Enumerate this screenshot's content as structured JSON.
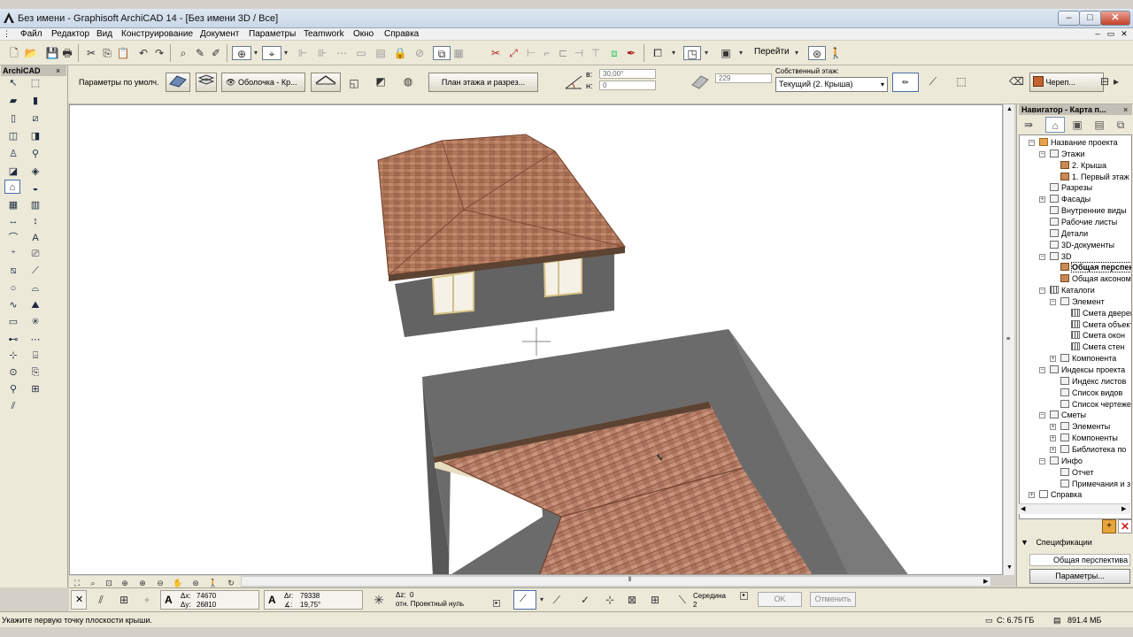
{
  "window": {
    "title": "Без имени - Graphisoft ArchiCAD 14 - [Без имени 3D / Все]",
    "min_label": "–",
    "max_label": "□",
    "close_label": "✕"
  },
  "menu": {
    "items": [
      "Файл",
      "Редактор",
      "Вид",
      "Конструирование",
      "Документ",
      "Параметры",
      "Teamwork",
      "Окно",
      "Справка"
    ],
    "mdi_min": "–",
    "mdi_restore": "▭",
    "mdi_close": "✕"
  },
  "toolbar": {
    "goto_label": "Перейти"
  },
  "infobox": {
    "default_params": "Параметры по умолч.",
    "shell_dropdown": "Оболочка - Кр...",
    "floorplan_btn": "План этажа и разрез...",
    "angle_label": "в:",
    "angle_value": "30,00°",
    "height_label": "н:",
    "height_value": "0",
    "thickness_value": "229",
    "home_story_label": "Собственный этаж:",
    "home_story_value": "Текущий (2. Крыша)",
    "material_label": "Череп..."
  },
  "toolbox": {
    "title": "ArchiCAD",
    "close": "×"
  },
  "navigator": {
    "title": "Навигатор - Карта п...",
    "tree": [
      {
        "label": "Название проекта",
        "level": 0,
        "icon": "folder",
        "exp": "−"
      },
      {
        "label": "Этажи",
        "level": 1,
        "icon": "plain",
        "exp": "−"
      },
      {
        "label": "2. Крыша",
        "level": 2,
        "icon": "roof",
        "exp": ""
      },
      {
        "label": "1. Первый этаж",
        "level": 2,
        "icon": "roof",
        "exp": ""
      },
      {
        "label": "Разрезы",
        "level": 1,
        "icon": "plain",
        "exp": ""
      },
      {
        "label": "Фасады",
        "level": 1,
        "icon": "plain",
        "exp": "+"
      },
      {
        "label": "Внутренние виды",
        "level": 1,
        "icon": "plain",
        "exp": ""
      },
      {
        "label": "Рабочие листы",
        "level": 1,
        "icon": "plain",
        "exp": ""
      },
      {
        "label": "Детали",
        "level": 1,
        "icon": "plain",
        "exp": ""
      },
      {
        "label": "3D-документы",
        "level": 1,
        "icon": "plain",
        "exp": ""
      },
      {
        "label": "3D",
        "level": 1,
        "icon": "plain",
        "exp": "−"
      },
      {
        "label": "Общая перспектива",
        "level": 2,
        "icon": "roof",
        "exp": "",
        "bold": true,
        "selected": true
      },
      {
        "label": "Общая аксонометрия",
        "level": 2,
        "icon": "roof",
        "exp": ""
      },
      {
        "label": "Каталоги",
        "level": 1,
        "icon": "grid",
        "exp": "−"
      },
      {
        "label": "Элемент",
        "level": 2,
        "icon": "plain",
        "exp": "−"
      },
      {
        "label": "Смета дверей",
        "level": 3,
        "icon": "grid",
        "exp": ""
      },
      {
        "label": "Смета объектов",
        "level": 3,
        "icon": "grid",
        "exp": ""
      },
      {
        "label": "Смета окон",
        "level": 3,
        "icon": "grid",
        "exp": ""
      },
      {
        "label": "Смета стен",
        "level": 3,
        "icon": "grid",
        "exp": ""
      },
      {
        "label": "Компонента",
        "level": 2,
        "icon": "plain",
        "exp": "+"
      },
      {
        "label": "Индексы проекта",
        "level": 1,
        "icon": "plain",
        "exp": "−"
      },
      {
        "label": "Индекс листов",
        "level": 2,
        "icon": "plain",
        "exp": ""
      },
      {
        "label": "Список видов",
        "level": 2,
        "icon": "plain",
        "exp": ""
      },
      {
        "label": "Список чертежей",
        "level": 2,
        "icon": "plain",
        "exp": ""
      },
      {
        "label": "Сметы",
        "level": 1,
        "icon": "plain",
        "exp": "−"
      },
      {
        "label": "Элементы",
        "level": 2,
        "icon": "plain",
        "exp": "+"
      },
      {
        "label": "Компоненты",
        "level": 2,
        "icon": "plain",
        "exp": "+"
      },
      {
        "label": "Библиотека по",
        "level": 2,
        "icon": "plain",
        "exp": "+"
      },
      {
        "label": "Инфо",
        "level": 1,
        "icon": "plain",
        "exp": "−"
      },
      {
        "label": "Отчет",
        "level": 2,
        "icon": "plain",
        "exp": ""
      },
      {
        "label": "Примечания и з",
        "level": 2,
        "icon": "plain",
        "exp": ""
      },
      {
        "label": "Справка",
        "level": 0,
        "icon": "help",
        "exp": "+"
      }
    ],
    "specs_label": "Спецификации",
    "view_name": "Общая перспектива",
    "params_btn": "Параметры..."
  },
  "controlbox": {
    "dx_label": "Δx:",
    "dx_value": "74670",
    "dy_label": "Δy:",
    "dy_value": "26810",
    "dr_label": "Δr:",
    "dr_value": "79338",
    "da_label": "∡:",
    "da_value": "19,75°",
    "dz_label": "Δz:",
    "dz_value": "0",
    "ref_label": "отн. Проектный нуль",
    "snap_label": "Середина",
    "snap_value": "2",
    "ok_btn": "OK",
    "cancel_btn": "Отменить"
  },
  "status": {
    "prompt": "Укажите первую точку плоскости крыши.",
    "disk": "C: 6.75 ГБ",
    "memory": "891.4 МБ"
  },
  "colors": {
    "roof_tile": "#b47b5e",
    "wall": "#6b6b6b",
    "accent": "#4c6da3"
  }
}
